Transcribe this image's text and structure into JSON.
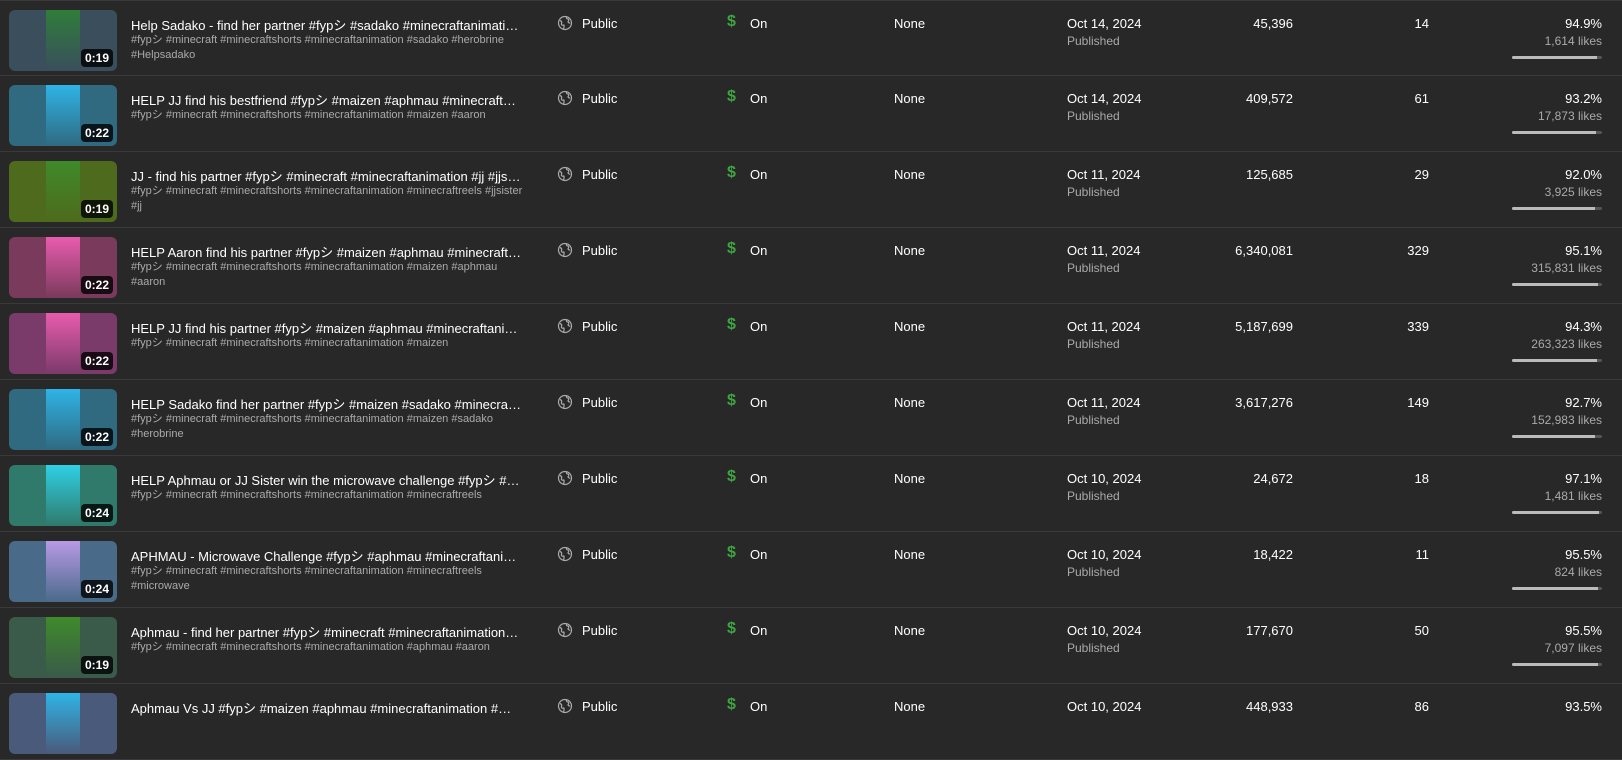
{
  "rows": [
    {
      "title": "Help Sadako - find her partner #fypシ #sadako #minecraftanimation #herobrine",
      "description": "#fypシ #minecraft #minecraftshorts #minecraftanimation #sadako #herobrine #Helpsadako",
      "duration": "0:19",
      "visibility": "Public",
      "monetization": "On",
      "restrictions": "None",
      "date": "Oct 14, 2024",
      "status": "Published",
      "views": "45,396",
      "comments": "14",
      "like_pct": "94.9%",
      "likes": "1,614 likes",
      "like_ratio": 0.949,
      "thumb_colors": [
        "#3a4e5c",
        "#2f7d3a"
      ]
    },
    {
      "title": "HELP JJ find his bestfriend #fypシ #maizen #aphmau #minecraftanimation",
      "description": "#fypシ #minecraft #minecraftshorts #minecraftanimation #maizen #aaron",
      "duration": "0:22",
      "visibility": "Public",
      "monetization": "On",
      "restrictions": "None",
      "date": "Oct 14, 2024",
      "status": "Published",
      "views": "409,572",
      "comments": "61",
      "like_pct": "93.2%",
      "likes": "17,873 likes",
      "like_ratio": 0.932,
      "thumb_colors": [
        "#2f6a80",
        "#2fb4e6"
      ]
    },
    {
      "title": "JJ - find his partner #fypシ #minecraft #minecraftanimation #jj #jjsister",
      "description": "#fypシ #minecraft #minecraftshorts #minecraftanimation #minecraftreels #jjsister #jj",
      "duration": "0:19",
      "visibility": "Public",
      "monetization": "On",
      "restrictions": "None",
      "date": "Oct 11, 2024",
      "status": "Published",
      "views": "125,685",
      "comments": "29",
      "like_pct": "92.0%",
      "likes": "3,925 likes",
      "like_ratio": 0.92,
      "thumb_colors": [
        "#4e6a1c",
        "#3f8a2a"
      ]
    },
    {
      "title": "HELP Aaron find his partner #fypシ #maizen #aphmau #minecraftanimation",
      "description": "#fypシ #minecraft #minecraftshorts #minecraftanimation #maizen #aphmau #aaron",
      "duration": "0:22",
      "visibility": "Public",
      "monetization": "On",
      "restrictions": "None",
      "date": "Oct 11, 2024",
      "status": "Published",
      "views": "6,340,081",
      "comments": "329",
      "like_pct": "95.1%",
      "likes": "315,831 likes",
      "like_ratio": 0.951,
      "thumb_colors": [
        "#7a3a5c",
        "#e85cae"
      ]
    },
    {
      "title": "HELP JJ find his partner #fypシ #maizen #aphmau #minecraftanimation",
      "description": "#fypシ #minecraft #minecraftshorts #minecraftanimation #maizen",
      "duration": "0:22",
      "visibility": "Public",
      "monetization": "On",
      "restrictions": "None",
      "date": "Oct 11, 2024",
      "status": "Published",
      "views": "5,187,699",
      "comments": "339",
      "like_pct": "94.3%",
      "likes": "263,323 likes",
      "like_ratio": 0.943,
      "thumb_colors": [
        "#7a3a6a",
        "#e85cae"
      ]
    },
    {
      "title": "HELP Sadako find her partner #fypシ #maizen #sadako #minecraftanimation",
      "description": "#fypシ #minecraft #minecraftshorts #minecraftanimation #maizen #sadako #herobrine",
      "duration": "0:22",
      "visibility": "Public",
      "monetization": "On",
      "restrictions": "None",
      "date": "Oct 11, 2024",
      "status": "Published",
      "views": "3,617,276",
      "comments": "149",
      "like_pct": "92.7%",
      "likes": "152,983 likes",
      "like_ratio": 0.927,
      "thumb_colors": [
        "#2f6a80",
        "#2fb4e6"
      ]
    },
    {
      "title": "HELP Aphmau or JJ Sister win the microwave challenge #fypシ #maizen #aphmau",
      "description": "#fypシ #minecraft #minecraftshorts #minecraftanimation #minecraftreels",
      "duration": "0:24",
      "visibility": "Public",
      "monetization": "On",
      "restrictions": "None",
      "date": "Oct 10, 2024",
      "status": "Published",
      "views": "24,672",
      "comments": "18",
      "like_pct": "97.1%",
      "likes": "1,481 likes",
      "like_ratio": 0.971,
      "thumb_colors": [
        "#2f7a6a",
        "#2fd0e6"
      ]
    },
    {
      "title": "APHMAU - Microwave Challenge #fypシ #aphmau #minecraftanimation #minecraft",
      "description": "#fypシ #minecraft #minecraftshorts #minecraftanimation #minecraftreels #microwave",
      "duration": "0:24",
      "visibility": "Public",
      "monetization": "On",
      "restrictions": "None",
      "date": "Oct 10, 2024",
      "status": "Published",
      "views": "18,422",
      "comments": "11",
      "like_pct": "95.5%",
      "likes": "824 likes",
      "like_ratio": 0.955,
      "thumb_colors": [
        "#4a6a8a",
        "#b89ae6"
      ]
    },
    {
      "title": "Aphmau - find her partner #fypシ #minecraft #minecraftanimation #aphmau",
      "description": "#fypシ #minecraft #minecraftshorts #minecraftanimation #aphmau #aaron",
      "duration": "0:19",
      "visibility": "Public",
      "monetization": "On",
      "restrictions": "None",
      "date": "Oct 10, 2024",
      "status": "Published",
      "views": "177,670",
      "comments": "50",
      "like_pct": "95.5%",
      "likes": "7,097 likes",
      "like_ratio": 0.955,
      "thumb_colors": [
        "#3a5a4a",
        "#3f8a2a"
      ]
    },
    {
      "title": "Aphmau Vs JJ #fypシ #maizen #aphmau #minecraftanimation #minecraft",
      "description": "",
      "duration": "",
      "visibility": "Public",
      "monetization": "On",
      "restrictions": "None",
      "date": "Oct 10, 2024",
      "status": "",
      "views": "448,933",
      "comments": "86",
      "like_pct": "93.5%",
      "likes": "",
      "like_ratio": 0.935,
      "thumb_colors": [
        "#4a5a7a",
        "#2fb4e6"
      ]
    }
  ],
  "icons": {
    "visibility": "globe-icon",
    "monetization": "dollar-icon"
  },
  "colors": {
    "background": "#282828",
    "monetization_green": "#3ea641",
    "secondary_text": "#aaaaaa"
  }
}
